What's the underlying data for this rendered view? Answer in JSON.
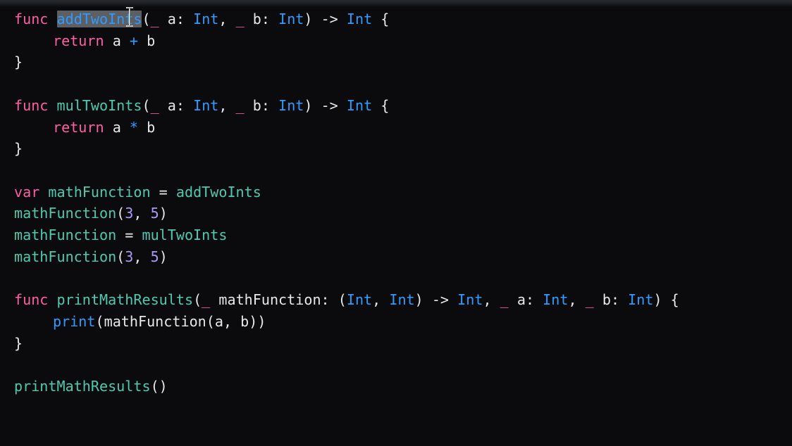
{
  "editor": {
    "lines": [
      {
        "tokens": [
          {
            "t": "func",
            "k": "kw"
          },
          {
            "t": " ",
            "k": "plain"
          },
          {
            "t": "addTwoInts",
            "k": "fn",
            "sel": true
          },
          {
            "t": "(",
            "k": "plain"
          },
          {
            "t": "_",
            "k": "kw"
          },
          {
            "t": " a: ",
            "k": "plain"
          },
          {
            "t": "Int",
            "k": "type"
          },
          {
            "t": ", ",
            "k": "plain"
          },
          {
            "t": "_",
            "k": "kw"
          },
          {
            "t": " b: ",
            "k": "plain"
          },
          {
            "t": "Int",
            "k": "type"
          },
          {
            "t": ") -> ",
            "k": "plain"
          },
          {
            "t": "Int",
            "k": "type"
          },
          {
            "t": " {",
            "k": "plain"
          }
        ]
      },
      {
        "indent": 1,
        "tokens": [
          {
            "t": "return",
            "k": "kw"
          },
          {
            "t": " a ",
            "k": "plain"
          },
          {
            "t": "+",
            "k": "type"
          },
          {
            "t": " b",
            "k": "plain"
          }
        ]
      },
      {
        "tokens": [
          {
            "t": "}",
            "k": "plain"
          }
        ]
      },
      {
        "tokens": []
      },
      {
        "tokens": [
          {
            "t": "func",
            "k": "kw"
          },
          {
            "t": " ",
            "k": "plain"
          },
          {
            "t": "mulTwoInts",
            "k": "fn"
          },
          {
            "t": "(",
            "k": "plain"
          },
          {
            "t": "_",
            "k": "kw"
          },
          {
            "t": " a: ",
            "k": "plain"
          },
          {
            "t": "Int",
            "k": "type"
          },
          {
            "t": ", ",
            "k": "plain"
          },
          {
            "t": "_",
            "k": "kw"
          },
          {
            "t": " b: ",
            "k": "plain"
          },
          {
            "t": "Int",
            "k": "type"
          },
          {
            "t": ") -> ",
            "k": "plain"
          },
          {
            "t": "Int",
            "k": "type"
          },
          {
            "t": " {",
            "k": "plain"
          }
        ]
      },
      {
        "indent": 1,
        "tokens": [
          {
            "t": "return",
            "k": "kw"
          },
          {
            "t": " a ",
            "k": "plain"
          },
          {
            "t": "*",
            "k": "type"
          },
          {
            "t": " b",
            "k": "plain"
          }
        ]
      },
      {
        "tokens": [
          {
            "t": "}",
            "k": "plain"
          }
        ]
      },
      {
        "tokens": []
      },
      {
        "tokens": [
          {
            "t": "var",
            "k": "kw"
          },
          {
            "t": " ",
            "k": "plain"
          },
          {
            "t": "mathFunction",
            "k": "fn"
          },
          {
            "t": " = ",
            "k": "plain"
          },
          {
            "t": "addTwoInts",
            "k": "fn"
          }
        ]
      },
      {
        "tokens": [
          {
            "t": "mathFunction",
            "k": "fn"
          },
          {
            "t": "(",
            "k": "plain"
          },
          {
            "t": "3",
            "k": "num"
          },
          {
            "t": ", ",
            "k": "plain"
          },
          {
            "t": "5",
            "k": "num"
          },
          {
            "t": ")",
            "k": "plain"
          }
        ]
      },
      {
        "tokens": [
          {
            "t": "mathFunction",
            "k": "fn"
          },
          {
            "t": " = ",
            "k": "plain"
          },
          {
            "t": "mulTwoInts",
            "k": "fn"
          }
        ]
      },
      {
        "tokens": [
          {
            "t": "mathFunction",
            "k": "fn"
          },
          {
            "t": "(",
            "k": "plain"
          },
          {
            "t": "3",
            "k": "num"
          },
          {
            "t": ", ",
            "k": "plain"
          },
          {
            "t": "5",
            "k": "num"
          },
          {
            "t": ")",
            "k": "plain"
          }
        ]
      },
      {
        "tokens": []
      },
      {
        "tokens": [
          {
            "t": "func",
            "k": "kw"
          },
          {
            "t": " ",
            "k": "plain"
          },
          {
            "t": "printMathResults",
            "k": "fn"
          },
          {
            "t": "(",
            "k": "plain"
          },
          {
            "t": "_",
            "k": "kw"
          },
          {
            "t": " mathFunction: (",
            "k": "plain"
          },
          {
            "t": "Int",
            "k": "type"
          },
          {
            "t": ", ",
            "k": "plain"
          },
          {
            "t": "Int",
            "k": "type"
          },
          {
            "t": ") -> ",
            "k": "plain"
          },
          {
            "t": "Int",
            "k": "type"
          },
          {
            "t": ", ",
            "k": "plain"
          },
          {
            "t": "_",
            "k": "kw"
          },
          {
            "t": " a: ",
            "k": "plain"
          },
          {
            "t": "Int",
            "k": "type"
          },
          {
            "t": ", ",
            "k": "plain"
          },
          {
            "t": "_",
            "k": "kw"
          },
          {
            "t": " b: ",
            "k": "plain"
          },
          {
            "t": "Int",
            "k": "type"
          },
          {
            "t": ") {",
            "k": "plain"
          }
        ]
      },
      {
        "indent": 1,
        "tokens": [
          {
            "t": "print",
            "k": "type"
          },
          {
            "t": "(mathFunction(a, b))",
            "k": "plain"
          }
        ]
      },
      {
        "tokens": [
          {
            "t": "}",
            "k": "plain"
          }
        ]
      },
      {
        "tokens": []
      },
      {
        "tokens": [
          {
            "t": "printMathResults",
            "k": "fn"
          },
          {
            "t": "()",
            "k": "plain"
          }
        ]
      }
    ]
  },
  "cursor": {
    "icon": "text-cursor-icon"
  },
  "colors": {
    "background": "#0b0b0d",
    "keyword": "#fc5fa3",
    "function": "#4ec9b0",
    "type": "#2f9bff",
    "number": "#a79df4",
    "plain": "#e8e8e8",
    "selection": "#5d5f63"
  }
}
